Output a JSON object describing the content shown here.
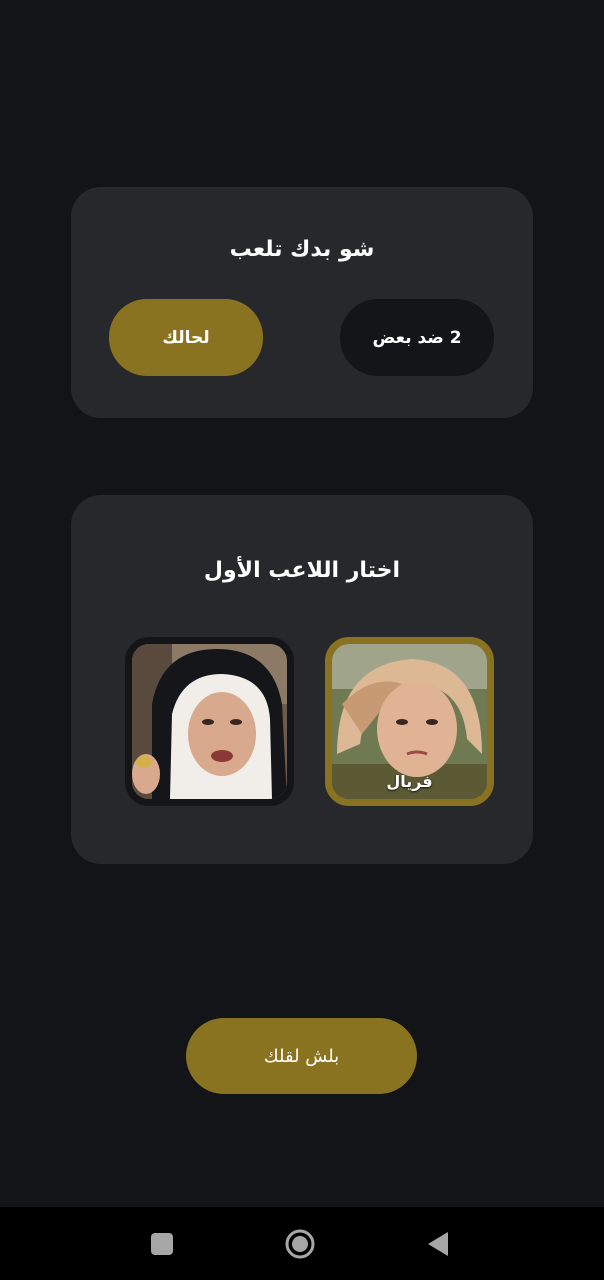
{
  "mode_card": {
    "title": "شو بدك تلعب",
    "solo_label": "لحالك",
    "versus_label": "2 ضد بعض",
    "selected": "solo"
  },
  "player_card": {
    "title": "اختار اللاعب الأول",
    "players": [
      {
        "name": "",
        "photo": "woman-black-headscarf-photo",
        "selected": false
      },
      {
        "name": "فريال",
        "photo": "woman-beige-headscarf-photo",
        "selected": true
      }
    ]
  },
  "start_button": {
    "label": "بلش لقلك"
  },
  "nav": {
    "recents": "square-recents-icon",
    "home": "circle-home-icon",
    "back": "triangle-back-icon"
  },
  "colors": {
    "background": "#131417",
    "card": "#27282b",
    "accent": "#8a7320",
    "dark_pill": "#141518"
  }
}
